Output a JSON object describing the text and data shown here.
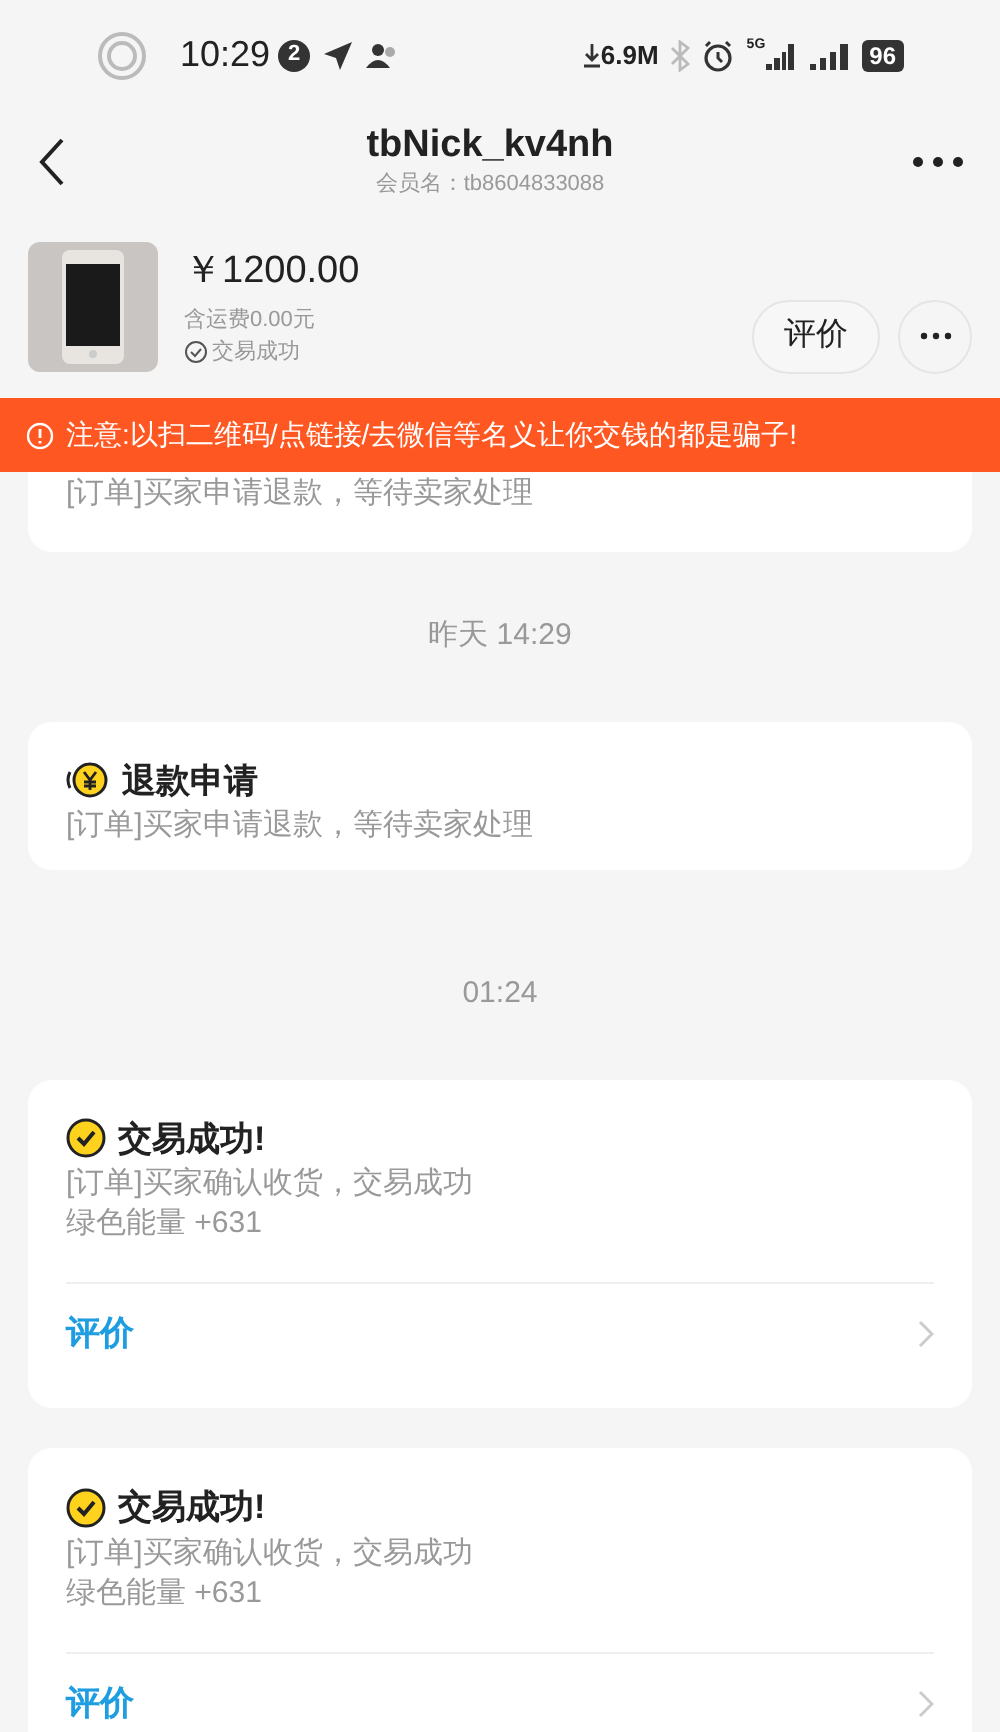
{
  "status_bar": {
    "time": "10:29",
    "notification_count": "2",
    "speed": "6.9M",
    "network": "5G",
    "battery": "96"
  },
  "header": {
    "title": "tbNick_kv4nh",
    "subtitle": "会员名：tb8604833088"
  },
  "order": {
    "price": "￥1200.00",
    "shipping": "含运费0.00元",
    "status": "交易成功",
    "buttons": [
      "评价"
    ]
  },
  "warning": "注意:以扫二维码/点链接/去微信等名义让你交钱的都是骗子!",
  "messages": [
    {
      "kind": "partial",
      "lines": [
        "[订单]买家申请退款，等待卖家处理"
      ]
    },
    {
      "kind": "time",
      "text": "昨天 14:29"
    },
    {
      "kind": "refund",
      "title": "退款申请",
      "lines": [
        "[订单]买家申请退款，等待卖家处理"
      ]
    },
    {
      "kind": "time",
      "text": "01:24"
    },
    {
      "kind": "success",
      "title": "交易成功!",
      "lines": [
        "[订单]买家确认收货，交易成功",
        "绿色能量 +631"
      ],
      "action": "评价"
    },
    {
      "kind": "success",
      "title": "交易成功!",
      "lines": [
        "[订单]买家确认收货，交易成功",
        "绿色能量 +631"
      ],
      "action": "评价"
    }
  ]
}
